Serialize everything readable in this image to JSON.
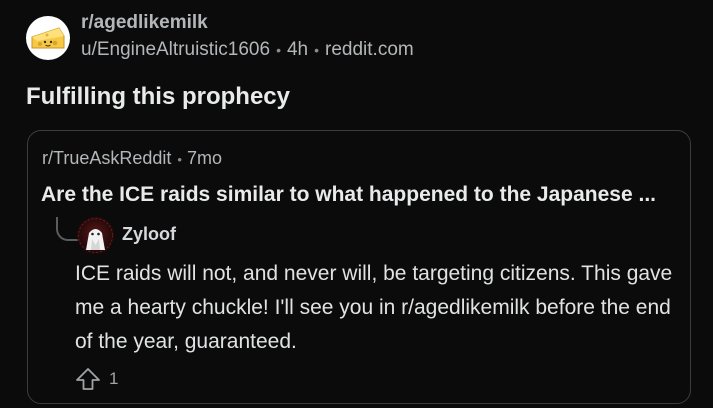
{
  "post": {
    "subreddit": "r/agedlikemilk",
    "author": "u/EngineAltruistic1606",
    "age": "4h",
    "domain": "reddit.com",
    "title": "Fulfilling this prophecy",
    "separator": "•",
    "avatar_icon": "cheese-icon"
  },
  "embedded": {
    "subreddit": "r/TrueAskReddit",
    "age": "7mo",
    "separator": "•",
    "title": "Are the ICE raids similar to what happened to the Japanese ...",
    "comment": {
      "user": "Zyloof",
      "avatar_icon": "user-avatar-icon",
      "body": "ICE raids will not, and never will, be targeting citizens. This gave me a hearty chuckle! I'll see you in r/agedlikemilk before the end of the year, guaranteed.",
      "upvotes": "1",
      "vote_icon": "upvote-arrow-icon"
    }
  },
  "colors": {
    "background": "#0b0b0b",
    "card_border": "#3a3d40",
    "text_primary": "#e8eaeb",
    "text_secondary": "#b3b7b9"
  }
}
